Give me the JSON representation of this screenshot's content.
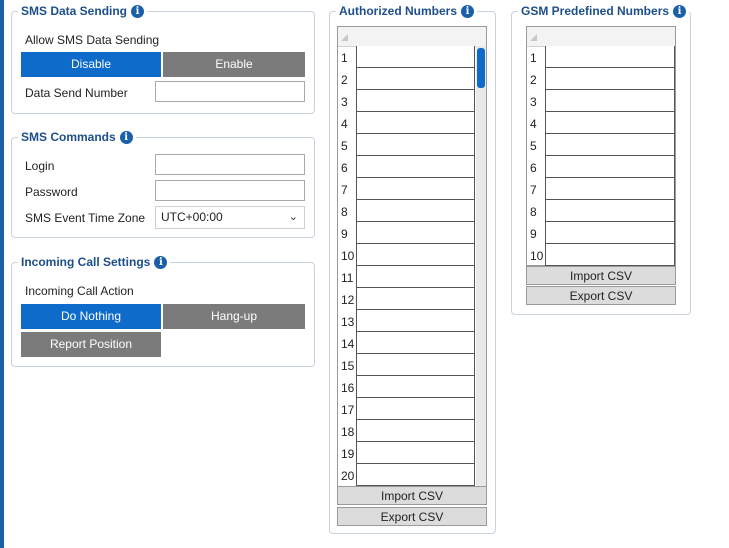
{
  "sms_data_sending": {
    "title": "SMS Data Sending",
    "allow_label": "Allow SMS Data Sending",
    "disable_label": "Disable",
    "enable_label": "Enable",
    "selected": "Disable",
    "send_number_label": "Data Send Number",
    "send_number_value": ""
  },
  "sms_commands": {
    "title": "SMS Commands",
    "login_label": "Login",
    "login_value": "",
    "password_label": "Password",
    "password_value": "",
    "timezone_label": "SMS Event Time Zone",
    "timezone_value": "UTC+00:00"
  },
  "incoming_call": {
    "title": "Incoming Call Settings",
    "action_label": "Incoming Call Action",
    "options": [
      "Do Nothing",
      "Hang-up",
      "Report Position"
    ],
    "selected": "Do Nothing"
  },
  "authorized_numbers": {
    "title": "Authorized Numbers",
    "rows": [
      "1",
      "2",
      "3",
      "4",
      "5",
      "6",
      "7",
      "8",
      "9",
      "10",
      "11",
      "12",
      "13",
      "14",
      "15",
      "16",
      "17",
      "18",
      "19",
      "20"
    ],
    "import_label": "Import CSV",
    "export_label": "Export CSV"
  },
  "gsm_predefined": {
    "title": "GSM Predefined Numbers",
    "rows": [
      "1",
      "2",
      "3",
      "4",
      "5",
      "6",
      "7",
      "8",
      "9",
      "10"
    ],
    "import_label": "Import CSV",
    "export_label": "Export CSV"
  },
  "icons": {
    "info": "info-icon",
    "chevron": "chevron-down-icon"
  },
  "colors": {
    "accent": "#0e6bc9",
    "inactive_button": "#7b7b7b",
    "title": "#1d4f8a"
  }
}
